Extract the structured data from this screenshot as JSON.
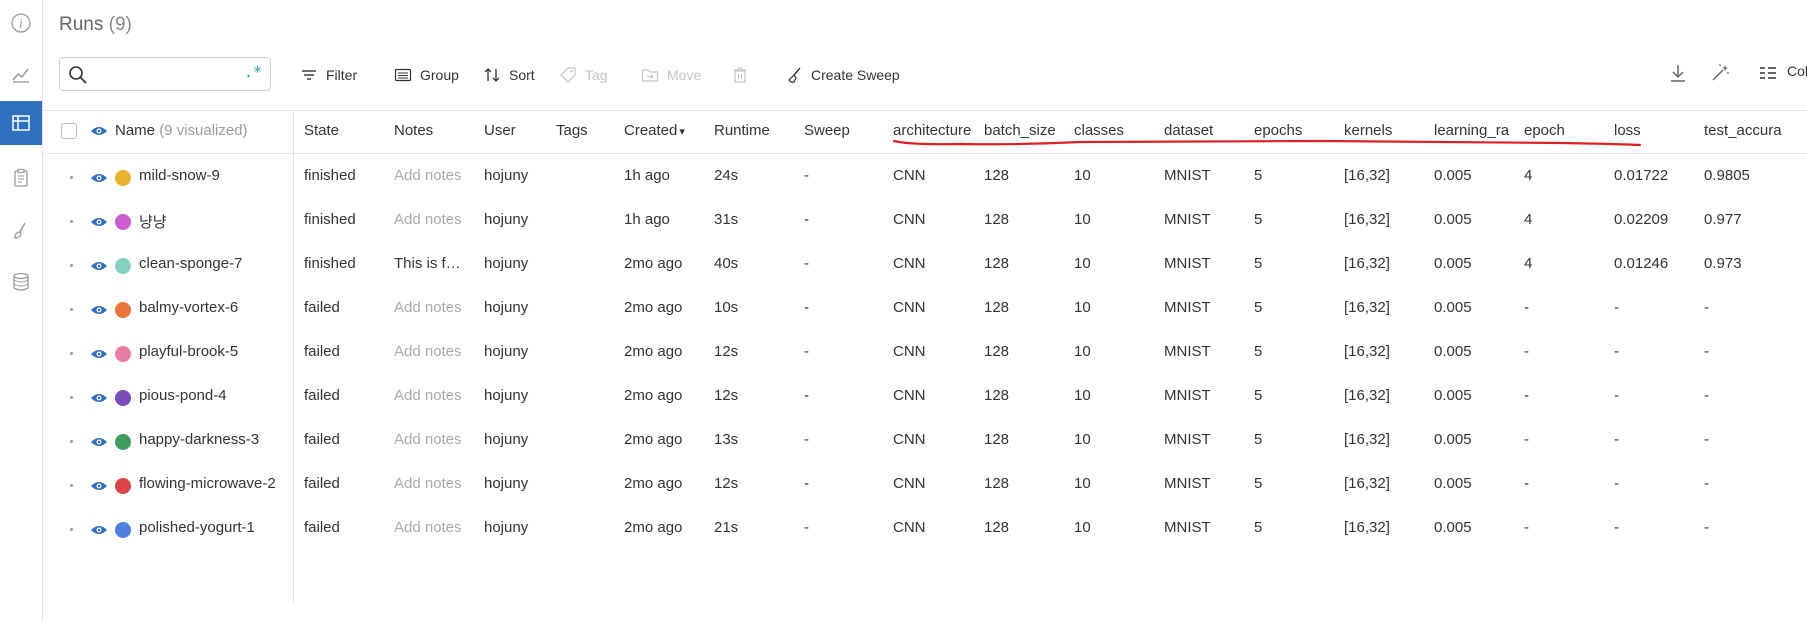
{
  "rail": {
    "items": [
      {
        "name": "info-icon"
      },
      {
        "name": "chart-line-icon"
      },
      {
        "name": "table-icon",
        "active": true
      },
      {
        "name": "clipboard-icon"
      },
      {
        "name": "brush-icon"
      },
      {
        "name": "database-icon"
      }
    ]
  },
  "page": {
    "title": "Runs",
    "count": "(9)"
  },
  "toolbar": {
    "search_placeholder": "",
    "regex_label": ".*",
    "filter": "Filter",
    "group": "Group",
    "sort": "Sort",
    "tag": "Tag",
    "move": "Move",
    "create_sweep": "Create Sweep",
    "columns": "Col"
  },
  "table": {
    "name_header": "Name",
    "name_sub": "(9 visualized)",
    "columns": [
      "State",
      "Notes",
      "User",
      "Tags",
      "Created",
      "Runtime",
      "Sweep",
      "architecture",
      "batch_size",
      "classes",
      "dataset",
      "epochs",
      "kernels",
      "learning_ra",
      "epoch",
      "loss",
      "test_accura"
    ],
    "sort_indicator": "▾",
    "rows": [
      {
        "name": "mild-snow-9",
        "color": "#e8b32e",
        "state": "finished",
        "notes": "Add notes",
        "notes_placeholder": true,
        "user": "hojuny",
        "tags": "",
        "created": "1h ago",
        "runtime": "24s",
        "sweep": "-",
        "architecture": "CNN",
        "batch_size": "128",
        "classes": "10",
        "dataset": "MNIST",
        "epochs": "5",
        "kernels": "[16,32]",
        "learning_rate": "0.005",
        "epoch": "4",
        "loss": "0.01722",
        "test_accuracy": "0.9805"
      },
      {
        "name": "냥냥",
        "color": "#c85ecf",
        "state": "finished",
        "notes": "Add notes",
        "notes_placeholder": true,
        "user": "hojuny",
        "tags": "",
        "created": "1h ago",
        "runtime": "31s",
        "sweep": "-",
        "architecture": "CNN",
        "batch_size": "128",
        "classes": "10",
        "dataset": "MNIST",
        "epochs": "5",
        "kernels": "[16,32]",
        "learning_rate": "0.005",
        "epoch": "4",
        "loss": "0.02209",
        "test_accuracy": "0.977"
      },
      {
        "name": "clean-sponge-7",
        "color": "#86d0c0",
        "state": "finished",
        "notes": "This is f…",
        "notes_placeholder": false,
        "user": "hojuny",
        "tags": "",
        "created": "2mo ago",
        "runtime": "40s",
        "sweep": "-",
        "architecture": "CNN",
        "batch_size": "128",
        "classes": "10",
        "dataset": "MNIST",
        "epochs": "5",
        "kernels": "[16,32]",
        "learning_rate": "0.005",
        "epoch": "4",
        "loss": "0.01246",
        "test_accuracy": "0.973"
      },
      {
        "name": "balmy-vortex-6",
        "color": "#e8743b",
        "state": "failed",
        "notes": "Add notes",
        "notes_placeholder": true,
        "user": "hojuny",
        "tags": "",
        "created": "2mo ago",
        "runtime": "10s",
        "sweep": "-",
        "architecture": "CNN",
        "batch_size": "128",
        "classes": "10",
        "dataset": "MNIST",
        "epochs": "5",
        "kernels": "[16,32]",
        "learning_rate": "0.005",
        "epoch": "-",
        "loss": "-",
        "test_accuracy": "-"
      },
      {
        "name": "playful-brook-5",
        "color": "#e87ea8",
        "state": "failed",
        "notes": "Add notes",
        "notes_placeholder": true,
        "user": "hojuny",
        "tags": "",
        "created": "2mo ago",
        "runtime": "12s",
        "sweep": "-",
        "architecture": "CNN",
        "batch_size": "128",
        "classes": "10",
        "dataset": "MNIST",
        "epochs": "5",
        "kernels": "[16,32]",
        "learning_rate": "0.005",
        "epoch": "-",
        "loss": "-",
        "test_accuracy": "-"
      },
      {
        "name": "pious-pond-4",
        "color": "#7b4bb8",
        "state": "failed",
        "notes": "Add notes",
        "notes_placeholder": true,
        "user": "hojuny",
        "tags": "",
        "created": "2mo ago",
        "runtime": "12s",
        "sweep": "-",
        "architecture": "CNN",
        "batch_size": "128",
        "classes": "10",
        "dataset": "MNIST",
        "epochs": "5",
        "kernels": "[16,32]",
        "learning_rate": "0.005",
        "epoch": "-",
        "loss": "-",
        "test_accuracy": "-"
      },
      {
        "name": "happy-darkness-3",
        "color": "#3f9b5b",
        "state": "failed",
        "notes": "Add notes",
        "notes_placeholder": true,
        "user": "hojuny",
        "tags": "",
        "created": "2mo ago",
        "runtime": "13s",
        "sweep": "-",
        "architecture": "CNN",
        "batch_size": "128",
        "classes": "10",
        "dataset": "MNIST",
        "epochs": "5",
        "kernels": "[16,32]",
        "learning_rate": "0.005",
        "epoch": "-",
        "loss": "-",
        "test_accuracy": "-"
      },
      {
        "name": "flowing-microwave-2",
        "color": "#db4548",
        "state": "failed",
        "notes": "Add notes",
        "notes_placeholder": true,
        "user": "hojuny",
        "tags": "",
        "created": "2mo ago",
        "runtime": "12s",
        "sweep": "-",
        "architecture": "CNN",
        "batch_size": "128",
        "classes": "10",
        "dataset": "MNIST",
        "epochs": "5",
        "kernels": "[16,32]",
        "learning_rate": "0.005",
        "epoch": "-",
        "loss": "-",
        "test_accuracy": "-"
      },
      {
        "name": "polished-yogurt-1",
        "color": "#4f7fe0",
        "state": "failed",
        "notes": "Add notes",
        "notes_placeholder": true,
        "user": "hojuny",
        "tags": "",
        "created": "2mo ago",
        "runtime": "21s",
        "sweep": "-",
        "architecture": "CNN",
        "batch_size": "128",
        "classes": "10",
        "dataset": "MNIST",
        "epochs": "5",
        "kernels": "[16,32]",
        "learning_rate": "0.005",
        "epoch": "-",
        "loss": "-",
        "test_accuracy": "-"
      }
    ]
  },
  "colors": {
    "accent": "#2f6fbf",
    "annotation_red": "#e02020",
    "eye_blue": "#2f6fbf"
  }
}
